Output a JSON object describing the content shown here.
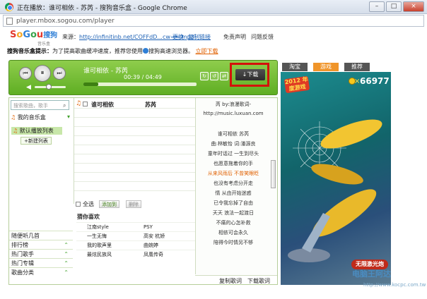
{
  "window": {
    "title": "正在播放：谁可相依 - 苏芮 - 搜狗音乐盒 - Google Chrome",
    "url": "player.mbox.sogou.com/player",
    "buttons": [
      "–",
      "□",
      "×"
    ]
  },
  "header": {
    "logo_text": "Sogou",
    "logo_cn": "搜狗",
    "logo_sub": "音乐盒",
    "source_label": "来源：",
    "source_url": "http://infinitinb.net/COFFdD...cw==.mp3",
    "switch_link": "更换",
    "copy_link": "复制链接",
    "disclaimer": "免责声明",
    "feedback": "问题反馈"
  },
  "notice": {
    "bold": "搜狗音乐盒提示：",
    "text": "为了提高歌曲缓冲速度，推荐您使用",
    "browser": "搜狗高速浏览器。",
    "action": "立即下载"
  },
  "player": {
    "song": "谁可相依 - 苏芮",
    "time": "00:39 / 04:49",
    "progress_fraction": 0.13,
    "volume_fraction": 0.45,
    "controls": [
      "⏮",
      "⏸",
      "⏭"
    ],
    "modes": [
      "↻",
      "↺",
      "⇄"
    ],
    "download_label": "↓下载"
  },
  "sidebar": {
    "search_placeholder": "搜索歌曲，歌手",
    "my_box": "我的音乐盒",
    "default_list": "默认播放列表",
    "new_list": "+新建列表",
    "categories": [
      {
        "label": "随便听几首"
      },
      {
        "label": "排行榜"
      },
      {
        "label": "热门歌手"
      },
      {
        "label": "热门专辑"
      },
      {
        "label": "歌曲分类"
      }
    ]
  },
  "songlist": {
    "rows": [
      {
        "title": "谁可相依",
        "artist": "苏芮"
      }
    ],
    "select_all": "全选",
    "add_to": "添加到",
    "delete": "删除"
  },
  "guess": {
    "title": "猜你喜欢",
    "rows": [
      {
        "song": "江南style",
        "artist": "PSY"
      },
      {
        "song": "一生无悔",
        "artist": "高安 杭娇"
      },
      {
        "song": "我的歌声里",
        "artist": "曲婉婷"
      },
      {
        "song": "最炫民族风",
        "artist": "凤凰传奇"
      }
    ]
  },
  "lyrics": {
    "lines": [
      "芮 by:浪漫歌词-",
      "http://music.luxuan.com",
      "",
      "谁可相依    苏芮",
      "曲:林敏怡  词:潘源良",
      "童年时话过  一生到尽头",
      "也愿意拖着你的手",
      "从来风雨后  不曾笑眼眨",
      "也没有考虑分开走",
      "情  从由开始迷惑",
      "已令我忘掉了自由",
      "天天  浪法一起渡日",
      "不痛的心怎补救",
      "相依可会永久",
      "陪得今时情另不够"
    ],
    "highlight_index": 7,
    "copy": "复制歌词",
    "download": "下载歌词"
  },
  "ad": {
    "tabs": [
      "淘宝",
      "游戏",
      "推荐"
    ],
    "active_tab": 1,
    "badge": "2012 年度游戏",
    "score": "66977",
    "laser": "无限激光炮"
  },
  "watermark": {
    "logo": "电脑王阿达",
    "url": "http://www.kocpc.com.tw"
  }
}
